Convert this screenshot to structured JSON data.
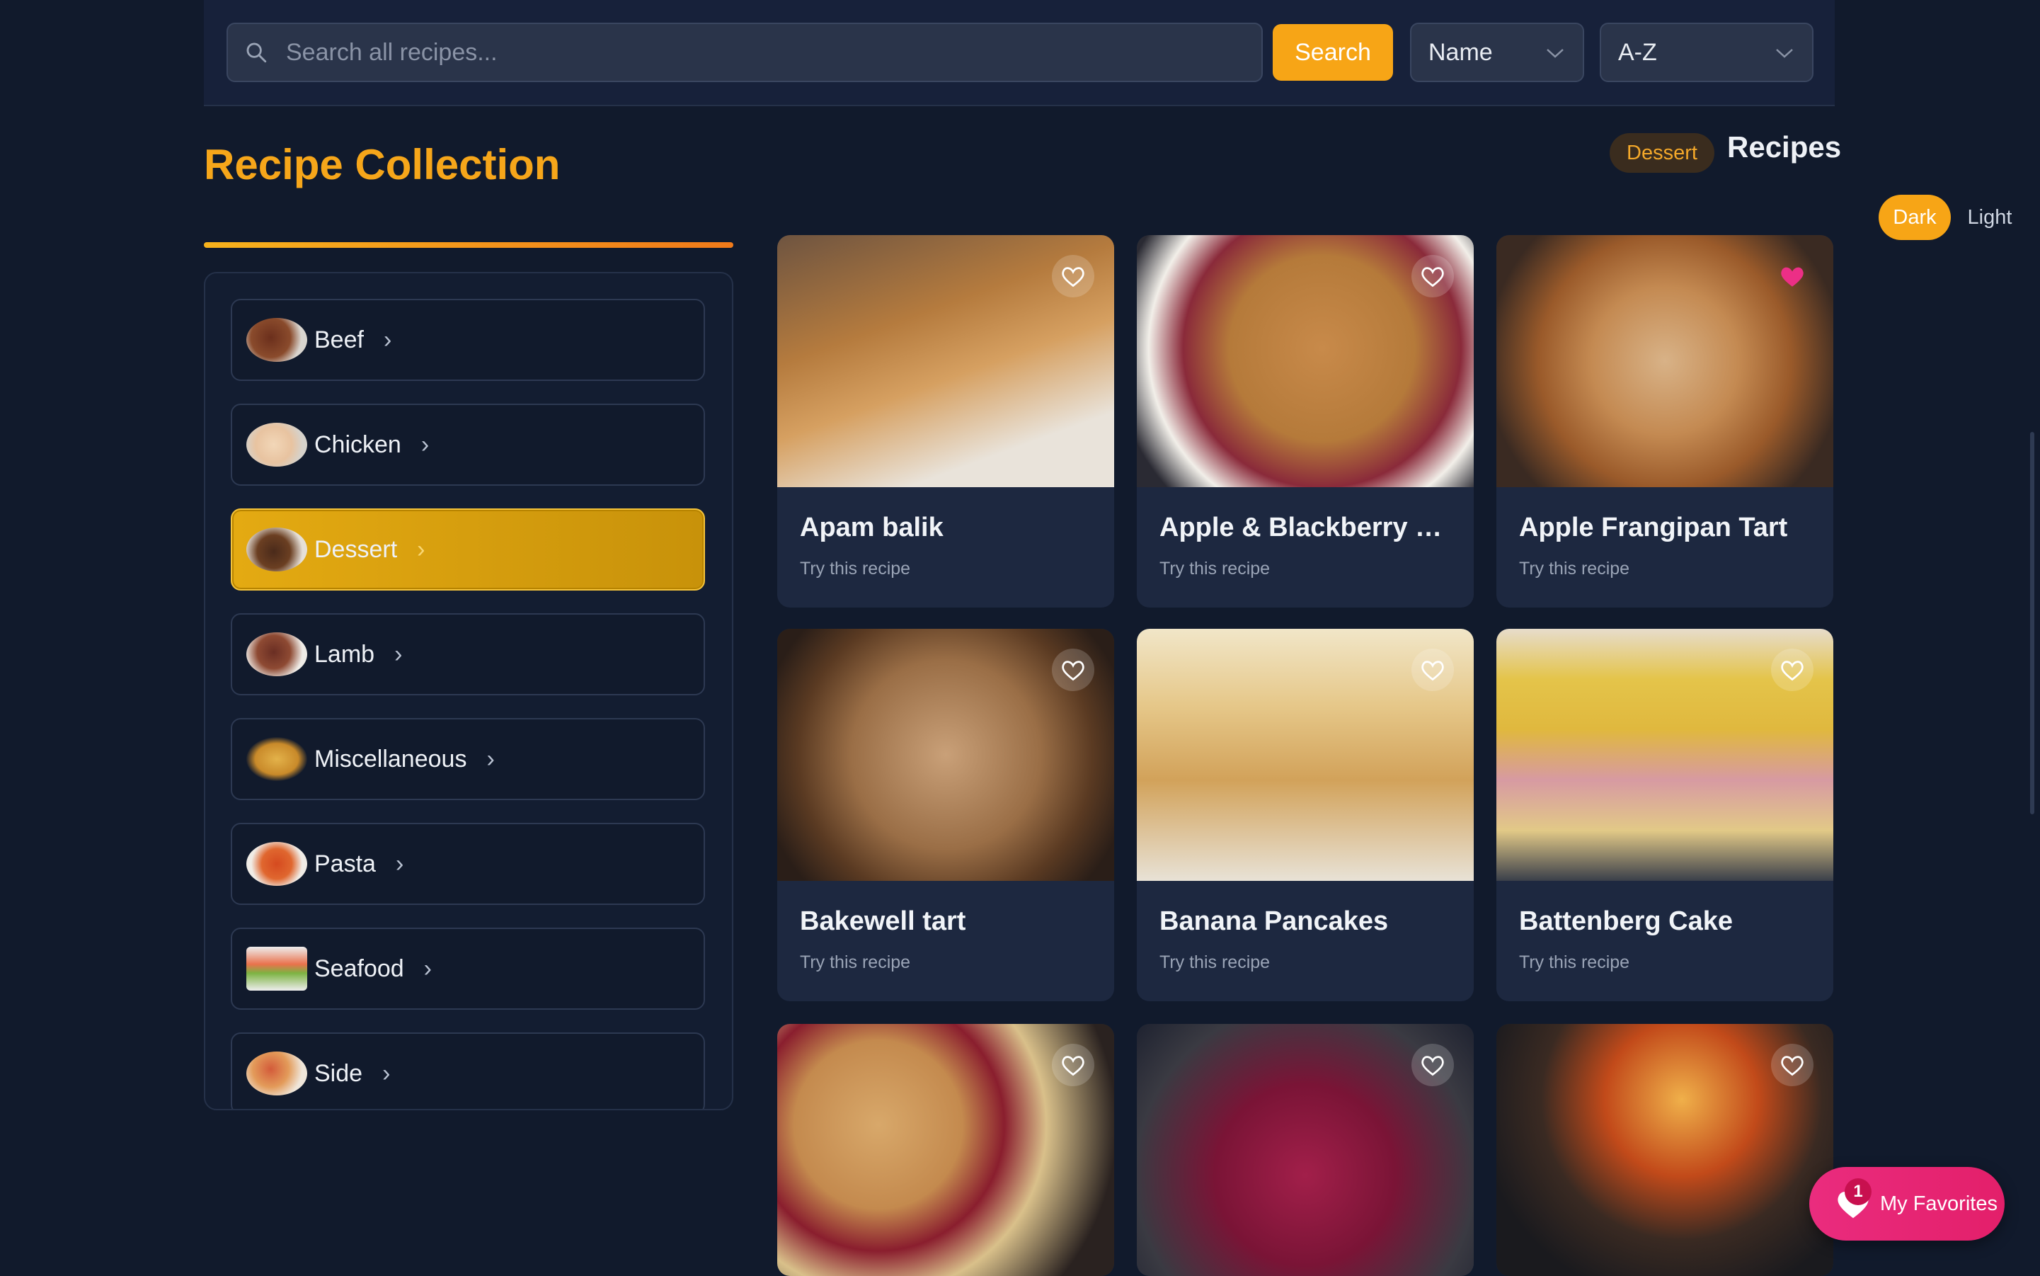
{
  "search": {
    "placeholder": "Search all recipes...",
    "button_label": "Search"
  },
  "sort": {
    "field": "Name",
    "order": "A-Z"
  },
  "page_title": "Recipe Collection",
  "header": {
    "category_badge": "Dessert",
    "heading": "Recipes"
  },
  "theme": {
    "dark_label": "Dark",
    "light_label": "Light",
    "selected": "Dark"
  },
  "categories": [
    {
      "label": "Beef",
      "active": false
    },
    {
      "label": "Chicken",
      "active": false
    },
    {
      "label": "Dessert",
      "active": true
    },
    {
      "label": "Lamb",
      "active": false
    },
    {
      "label": "Miscellaneous",
      "active": false
    },
    {
      "label": "Pasta",
      "active": false
    },
    {
      "label": "Seafood",
      "active": false
    },
    {
      "label": "Side",
      "active": false
    }
  ],
  "recipes": [
    {
      "title": "Apam balik",
      "subtitle": "Try this recipe",
      "favorited": false
    },
    {
      "title": "Apple & Blackberry Cr...",
      "subtitle": "Try this recipe",
      "favorited": false
    },
    {
      "title": "Apple Frangipan Tart",
      "subtitle": "Try this recipe",
      "favorited": true
    },
    {
      "title": "Bakewell tart",
      "subtitle": "Try this recipe",
      "favorited": false
    },
    {
      "title": "Banana Pancakes",
      "subtitle": "Try this recipe",
      "favorited": false
    },
    {
      "title": "Battenberg Cake",
      "subtitle": "Try this recipe",
      "favorited": false
    },
    {
      "title": "",
      "subtitle": "",
      "favorited": false
    },
    {
      "title": "",
      "subtitle": "",
      "favorited": false
    },
    {
      "title": "",
      "subtitle": "",
      "favorited": false
    }
  ],
  "favorites": {
    "label": "My Favorites",
    "count": "1"
  },
  "colors": {
    "accent": "#f7a516",
    "background": "#111a2c",
    "favorite": "#e31f6a"
  }
}
